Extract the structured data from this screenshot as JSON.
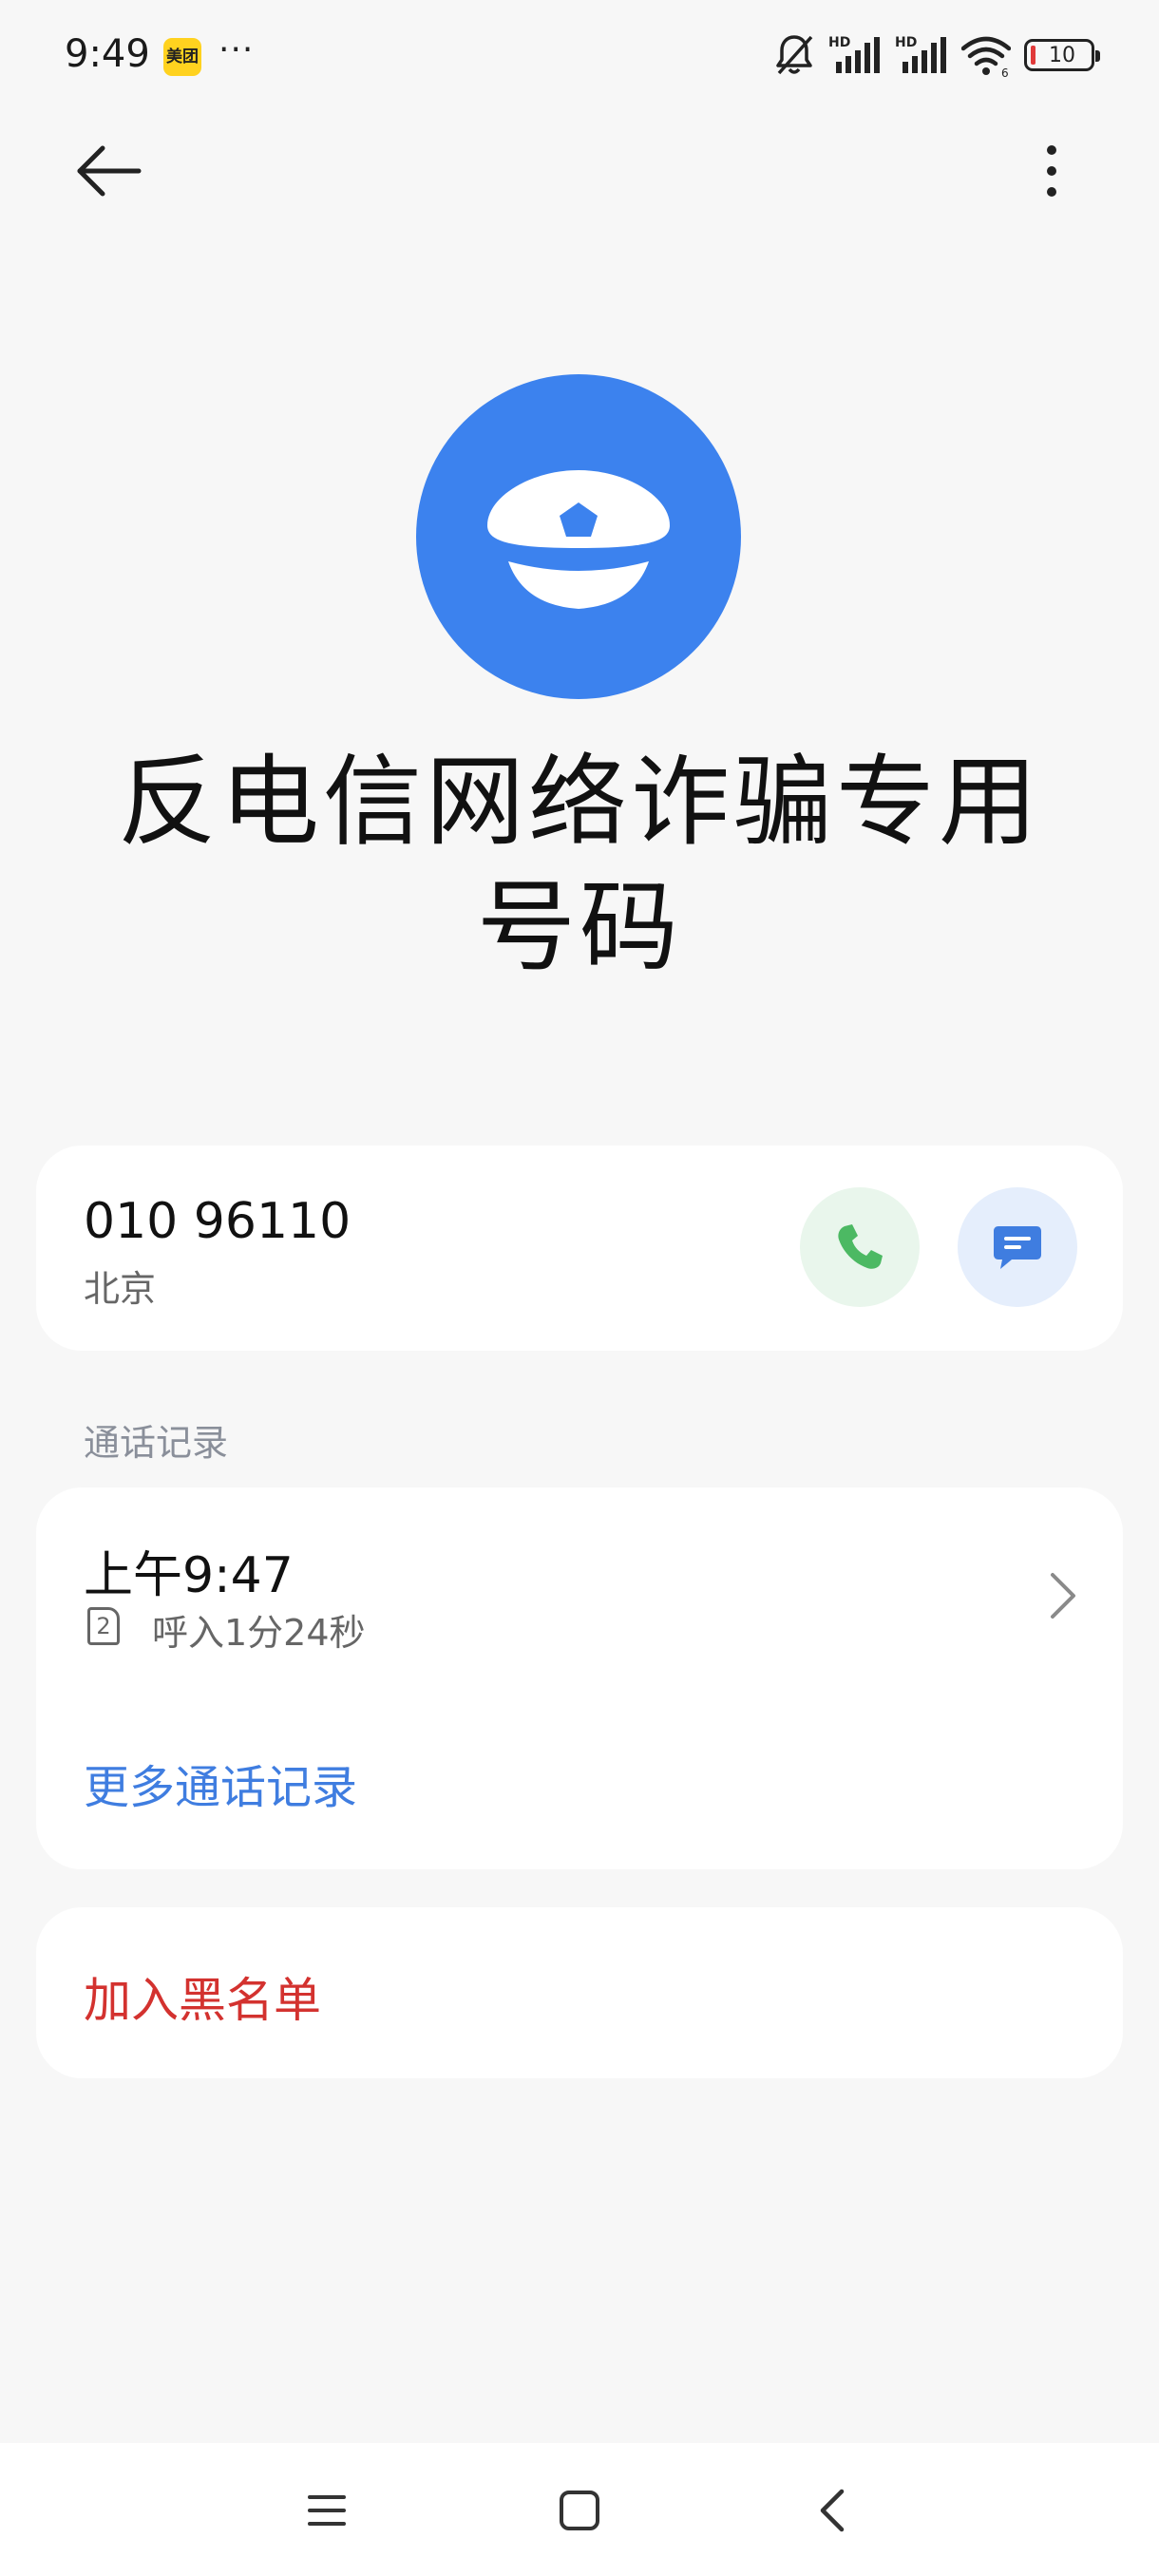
{
  "status_bar": {
    "time": "9:49",
    "app_badge": "美团",
    "overflow_dots": "···",
    "battery_percent": "10",
    "icons": [
      "mute-icon",
      "hd-signal-icon",
      "hd-signal-icon",
      "wifi-icon",
      "battery-icon"
    ]
  },
  "toolbar": {
    "back_icon": "arrow-left-icon",
    "more_icon": "vertical-dots-icon"
  },
  "contact": {
    "avatar_icon": "police-cap-icon",
    "avatar_color": "#3c82ee",
    "name": "反电信网络诈骗专用号码"
  },
  "number_card": {
    "number": "010 96110",
    "location": "北京",
    "call_icon": "phone-icon",
    "call_color": "#4cb963",
    "message_icon": "message-icon",
    "message_color": "#3f7de0"
  },
  "call_history": {
    "section_label": "通话记录",
    "entries": [
      {
        "time": "上午9:47",
        "sim": "2",
        "detail": "呼入1分24秒"
      }
    ],
    "more_label": "更多通话记录",
    "more_color": "#3f7de0"
  },
  "block": {
    "label": "加入黑名单",
    "color": "#d3322f"
  },
  "nav_bar": {
    "items": [
      "menu-icon",
      "home-icon",
      "back-icon"
    ]
  }
}
